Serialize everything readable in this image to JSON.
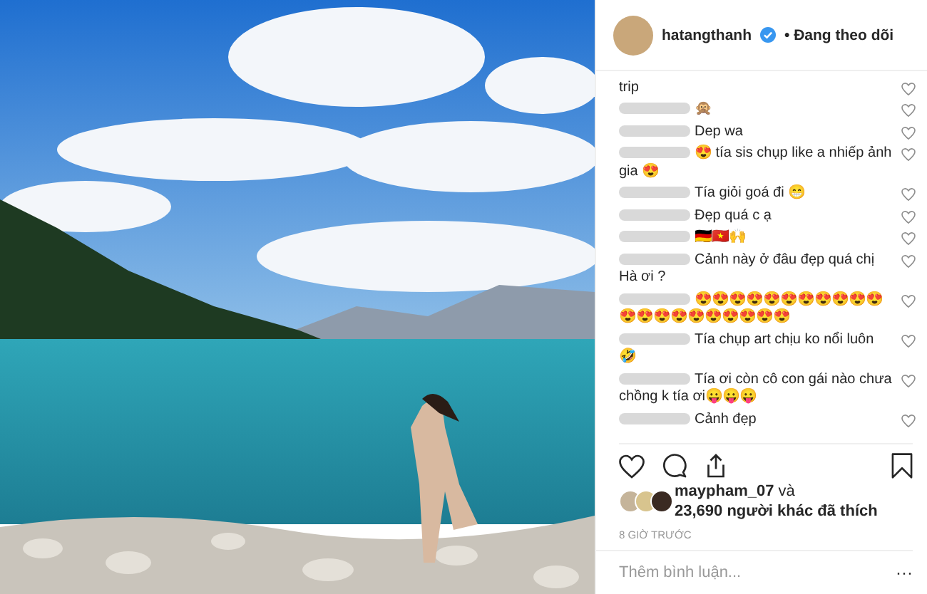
{
  "post": {
    "username": "hatangthanh",
    "verified": true,
    "follow_status": "• Đang theo dõi"
  },
  "comments": [
    {
      "text": "trip",
      "redacted_author": false
    },
    {
      "text": "🙊",
      "redacted_author": true
    },
    {
      "text": "Dep wa",
      "redacted_author": true
    },
    {
      "text": "😍 tía sis chụp like a nhiếp ảnh gia 😍",
      "redacted_author": true
    },
    {
      "text": "Tía giỏi goá đi 😁",
      "redacted_author": true
    },
    {
      "text": "Đẹp quá c ạ",
      "redacted_author": true
    },
    {
      "text": "🇩🇪🇻🇳🙌",
      "redacted_author": true
    },
    {
      "text": "Cảnh này ở đâu đẹp quá chị Hà ơi ?",
      "redacted_author": true
    },
    {
      "text": "😍😍😍😍😍😍😍😍😍😍😍😍😍😍😍😍😍😍😍😍😍",
      "redacted_author": true
    },
    {
      "text": "Tía chụp art chịu ko nổi luôn 🤣",
      "redacted_author": true
    },
    {
      "text": "Tía ơi còn cô con gái nào chưa chồng k tía ơi😛😛😛",
      "redacted_author": true
    },
    {
      "text": "Cảnh đẹp",
      "redacted_author": true
    }
  ],
  "likes": {
    "first_user": "maypham_07",
    "first_suffix": "và",
    "count_text": "23,690 người khác đã thích"
  },
  "time": "8 GIỜ TRƯỚC",
  "comment_field": {
    "placeholder": "Thêm bình luận..."
  },
  "more": "···"
}
